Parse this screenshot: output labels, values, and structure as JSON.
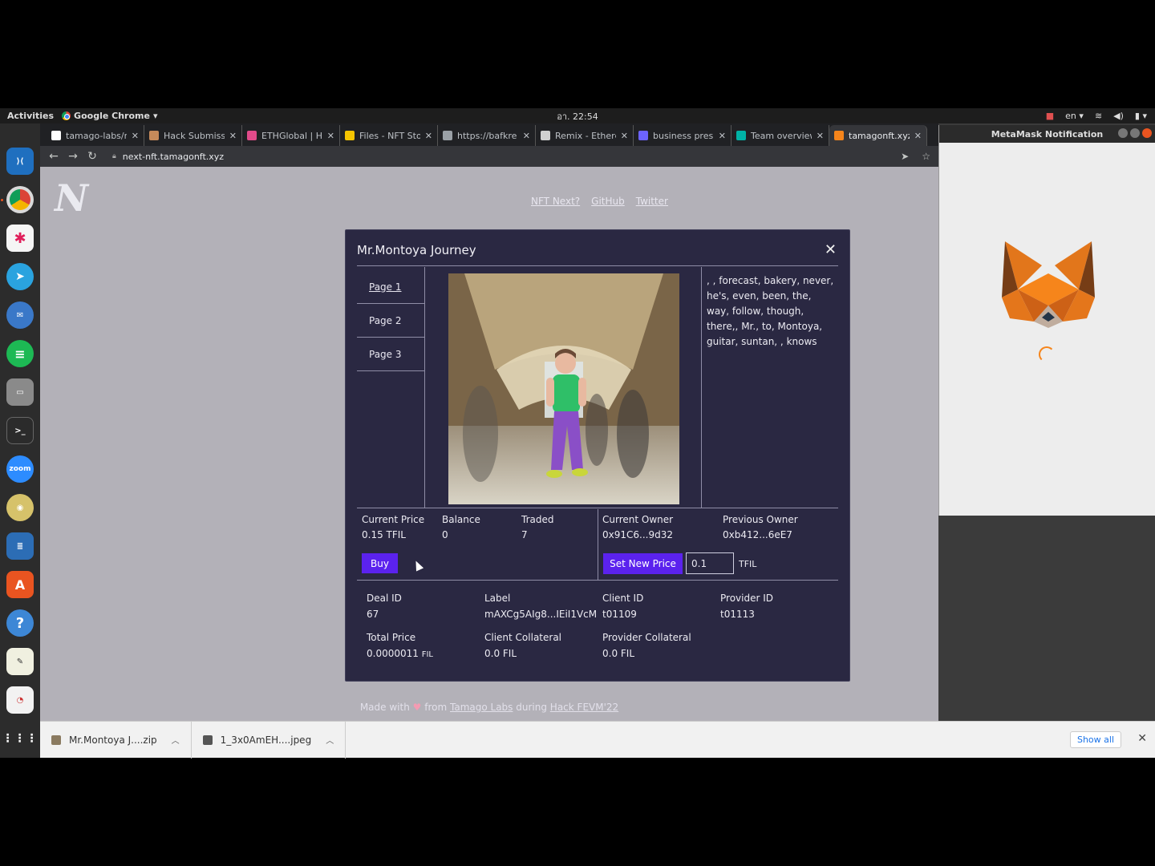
{
  "topbar": {
    "activities": "Activities",
    "app": "Google Chrome",
    "clock": "อา. 22:54",
    "lang": "en"
  },
  "tabs": [
    {
      "label": "tamago-labs/n",
      "color": "#ffffff"
    },
    {
      "label": "Hack Submiss",
      "color": "#c58a5a"
    },
    {
      "label": "ETHGlobal | H",
      "color": "#e14b8a"
    },
    {
      "label": "Files - NFT Sto",
      "color": "#f5c400"
    },
    {
      "label": "https://bafkre",
      "color": "#9aa0a6"
    },
    {
      "label": "Remix - Ethere",
      "color": "#d0d0d0"
    },
    {
      "label": "business pres",
      "color": "#6c63ff"
    },
    {
      "label": "Team overview",
      "color": "#00b3a6"
    },
    {
      "label": "tamagonft.xyz",
      "color": "#f6851b"
    }
  ],
  "url": "next-nft.tamagonft.xyz",
  "nav": {
    "links": [
      "NFT Next?",
      "GitHub",
      "Twitter"
    ]
  },
  "modal": {
    "title": "Mr.Montoya Journey",
    "pages": [
      "Page 1",
      "Page 2",
      "Page 3"
    ],
    "words": ", , forecast, bakery, never, he's, even, been, the, way, follow, though, there,, Mr., to, Montoya, guitar, suntan, , knows",
    "stats": {
      "current_price_label": "Current Price",
      "current_price": "0.15 TFIL",
      "balance_label": "Balance",
      "balance": "0",
      "traded_label": "Traded",
      "traded": "7",
      "current_owner_label": "Current Owner",
      "current_owner": "0x91C6...9d32",
      "previous_owner_label": "Previous Owner",
      "previous_owner": "0xb412...6eE7"
    },
    "buy_label": "Buy",
    "set_price_label": "Set New Price",
    "price_input_value": "0.1",
    "price_unit": "TFIL",
    "deal": {
      "deal_id_label": "Deal ID",
      "deal_id": "67",
      "label_label": "Label",
      "label": "mAXCg5AIg8...IEiI1VcM",
      "client_id_label": "Client ID",
      "client_id": "t01109",
      "provider_id_label": "Provider ID",
      "provider_id": "t01113",
      "total_price_label": "Total Price",
      "total_price": "0.0000011",
      "total_price_unit": "FIL",
      "client_collateral_label": "Client Collateral",
      "client_collateral": "0.0 FIL",
      "provider_collateral_label": "Provider Collateral",
      "provider_collateral": "0.0 FIL"
    }
  },
  "footer": {
    "made_with": "Made with",
    "from": "from",
    "tamago": "Tamago Labs",
    "during": "during",
    "hack": "Hack FEVM'22"
  },
  "metamask": {
    "title": "MetaMask Notification"
  },
  "downloads": [
    {
      "name": "Mr.Montoya J....zip"
    },
    {
      "name": "1_3x0AmEH....jpeg"
    }
  ],
  "show_all": "Show all"
}
